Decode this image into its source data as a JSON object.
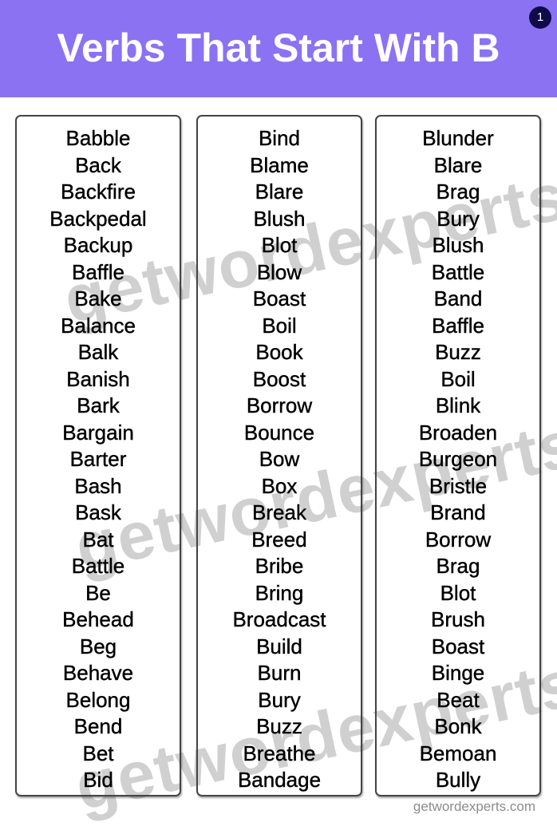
{
  "header": {
    "title": "Verbs That Start With B",
    "page_badge": "1",
    "background_color": "#8a72f3",
    "badge_color": "#0f0a4a"
  },
  "columns": [
    {
      "words": [
        "Babble",
        "Back",
        "Backfire",
        "Backpedal",
        "Backup",
        "Baffle",
        "Bake",
        "Balance",
        "Balk",
        "Banish",
        "Bark",
        "Bargain",
        "Barter",
        "Bash",
        "Bask",
        "Bat",
        "Battle",
        "Be",
        "Behead",
        "Beg",
        "Behave",
        "Belong",
        "Bend",
        "Bet",
        "Bid"
      ]
    },
    {
      "words": [
        "Bind",
        "Blame",
        "Blare",
        "Blush",
        "Blot",
        "Blow",
        "Boast",
        "Boil",
        "Book",
        "Boost",
        "Borrow",
        "Bounce",
        "Bow",
        "Box",
        "Break",
        "Breed",
        "Bribe",
        "Bring",
        "Broadcast",
        "Build",
        "Burn",
        "Bury",
        "Buzz",
        "Breathe",
        "Bandage"
      ]
    },
    {
      "words": [
        "Blunder",
        "Blare",
        "Brag",
        "Bury",
        "Blush",
        "Battle",
        "Band",
        "Baffle",
        "Buzz",
        "Boil",
        "Blink",
        "Broaden",
        "Burgeon",
        "Bristle",
        "Brand",
        "Borrow",
        "Brag",
        "Blot",
        "Brush",
        "Boast",
        "Binge",
        "Beat",
        "Bonk",
        "Bemoan",
        "Bully"
      ]
    }
  ],
  "watermark": "getwordexperts.com",
  "footer": "getwordexperts.com"
}
